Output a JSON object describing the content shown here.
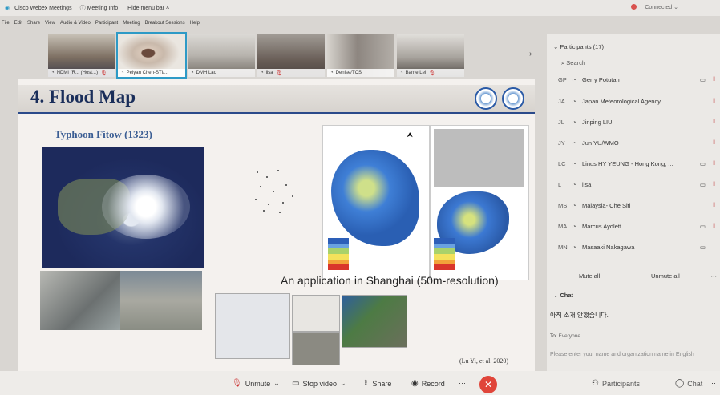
{
  "app": {
    "title": "Cisco Webex Meetings",
    "meeting_info": "Meeting Info",
    "hide_menu_bar": "Hide menu bar",
    "connected": "Connected"
  },
  "menu": [
    "File",
    "Edit",
    "Share",
    "View",
    "Audio & Video",
    "Participant",
    "Meeting",
    "Breakout Sessions",
    "Help"
  ],
  "video_strip": [
    {
      "name": "NDMI (R... (Host...)"
    },
    {
      "name": "Peiyan Chen-STI/..."
    },
    {
      "name": "DMH Lao"
    },
    {
      "name": "lisa"
    },
    {
      "name": "Denise/TCS"
    },
    {
      "name": "Barrie Lei"
    }
  ],
  "slide": {
    "title": "4. Flood Map",
    "subtitle": "Typhoon Fitow (1323)",
    "caption": "An application in Shanghai (50m-resolution)",
    "citation": "(Lu Yi, et al. 2020)"
  },
  "controls": {
    "unmute": "Unmute",
    "stop_video": "Stop video",
    "share": "Share",
    "record": "Record",
    "more": "···",
    "end": "✕",
    "participants": "Participants",
    "chat": "Chat"
  },
  "panel": {
    "participants_header": "Participants (17)",
    "search_placeholder": "Search",
    "participants": [
      {
        "initials": "GP",
        "name": "Gerry Potutan",
        "camera": true
      },
      {
        "initials": "JA",
        "name": "Japan Meteorological Agency",
        "camera": false
      },
      {
        "initials": "JL",
        "name": "Jinping LIU",
        "camera": false
      },
      {
        "initials": "JY",
        "name": "Jun YU/WMO",
        "camera": false
      },
      {
        "initials": "LC",
        "name": "Linus HY YEUNG - Hong Kong, ...",
        "camera": true
      },
      {
        "initials": "L",
        "name": "lisa",
        "camera": true
      },
      {
        "initials": "MS",
        "name": "Malaysia- Che Siti",
        "camera": false
      },
      {
        "initials": "MA",
        "name": "Marcus Aydlett",
        "camera": true
      },
      {
        "initials": "MN",
        "name": "Masaaki Nakagawa",
        "camera": true
      }
    ],
    "mute_all": "Mute all",
    "unmute_all": "Unmute all",
    "chat_header": "Chat",
    "chat_message": "아직 소개 안했습니다.",
    "to_label": "To:",
    "to_value": "Everyone",
    "chat_placeholder": "Please enter your name and organization name in English"
  }
}
